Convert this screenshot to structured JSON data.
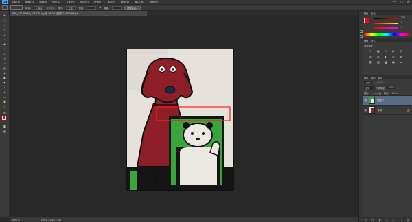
{
  "menu": {
    "logo": "Ps",
    "items": [
      "文件(F)",
      "编辑(E)",
      "图像(I)",
      "图层(L)",
      "文字(Y)",
      "选择(S)",
      "滤镜(T)",
      "3D(D)",
      "视图(V)",
      "窗口(W)",
      "帮助(H)"
    ]
  },
  "window_controls": {
    "minimize": "—",
    "maximize": "□",
    "close": "✕"
  },
  "options": {
    "feather_label": "羽化:",
    "feather_value": "0 像素",
    "antialias_label": "消除锯齿",
    "style_label": "样式:",
    "style_value": "正常",
    "width_label": "宽度:",
    "height_label": "高度:",
    "refine_button": "调整边缘..."
  },
  "document": {
    "tab_title": "IMG_20170926_104725.jpg @ 16.7% (图层 1, RGB/8#) *"
  },
  "status": {
    "zoom": "16.67%",
    "doc_size": "文档:6.02M/12.0M"
  },
  "color_panel": {
    "tabs": [
      "颜色",
      "色板"
    ],
    "r": "255",
    "g": "0",
    "b": "0"
  },
  "adjust_panel": {
    "tabs": [
      "调整",
      "样式"
    ],
    "add_label": "添加调整"
  },
  "layers_panel": {
    "tabs": [
      "图层",
      "通道",
      "路径"
    ],
    "kind_label": "类型",
    "mode_value": "正常",
    "opacity_label": "不透明度:",
    "opacity_value": "100%",
    "lock_label": "锁定:",
    "fill_label": "填充:",
    "fill_value": "100%",
    "layers": [
      {
        "name": "图层 1",
        "selected": true
      },
      {
        "name": "背景",
        "selected": false
      }
    ]
  },
  "watermark": {
    "text": "快 首 设"
  },
  "colors": {
    "accent": "#ff0000",
    "selection": "#5a6d86",
    "green_bg": "#3aa53a",
    "dog_red": "#8e1f28"
  }
}
